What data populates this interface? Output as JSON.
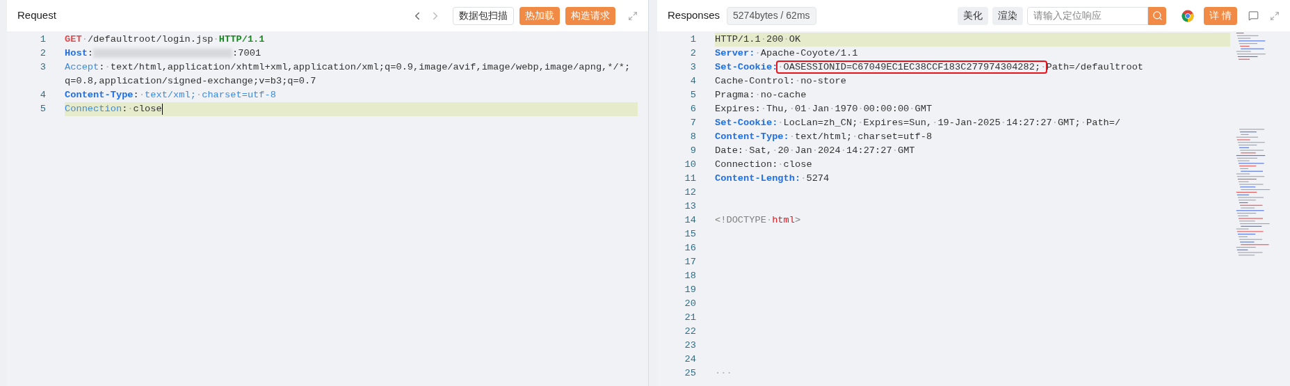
{
  "request": {
    "title": "Request",
    "buttons": [
      {
        "label": "数据包扫描",
        "kind": "outline"
      },
      {
        "label": "热加载",
        "kind": "primary"
      },
      {
        "label": "构造请求",
        "kind": "primary"
      }
    ],
    "lines": [
      {
        "number": "1",
        "current": false,
        "segments": [
          {
            "kind": "method",
            "text": "GET"
          },
          {
            "kind": "value",
            "text": "·/defaultroot/login.jsp·"
          },
          {
            "kind": "protocol",
            "text": "HTTP/1.1"
          }
        ]
      },
      {
        "number": "2",
        "current": false,
        "segments": [
          {
            "kind": "header-bold",
            "text": "Host"
          },
          {
            "kind": "value",
            "text": ":"
          },
          {
            "kind": "redacted"
          },
          {
            "kind": "value",
            "text": ":7001"
          }
        ]
      },
      {
        "number": "3",
        "current": false,
        "segments": [
          {
            "kind": "header",
            "text": "Accept"
          },
          {
            "kind": "value",
            "text": ":·text/html,application/xhtml+xml,application/xml;q=0.9,image/avif,image/webp,image/apng,*/*;"
          }
        ],
        "continuation": "q=0.8,application/signed-exchange;v=b3;q=0.7"
      },
      {
        "number": "4",
        "current": false,
        "segments": [
          {
            "kind": "header-bold",
            "text": "Content-Type"
          },
          {
            "kind": "value",
            "text": ":·"
          },
          {
            "kind": "value-blue",
            "text": "text/xml;·charset=utf-8"
          }
        ]
      },
      {
        "number": "5",
        "current": true,
        "segments": [
          {
            "kind": "header",
            "text": "Connection"
          },
          {
            "kind": "value",
            "text": ":·close"
          }
        ]
      }
    ]
  },
  "response": {
    "title": "Responses",
    "stats": "5274bytes / 62ms",
    "buttons": [
      {
        "label": "美化",
        "kind": "gray"
      },
      {
        "label": "渲染",
        "kind": "gray"
      }
    ],
    "search": {
      "placeholder": "请输入定位响应"
    },
    "detail_button": "详 情",
    "lines": [
      {
        "number": "1",
        "current": true,
        "segments": [
          {
            "kind": "value",
            "text": "HTTP/1.1·200·OK"
          }
        ]
      },
      {
        "number": "2",
        "current": false,
        "segments": [
          {
            "kind": "header-bold",
            "text": "Server:"
          },
          {
            "kind": "value",
            "text": "·Apache-Coyote/1.1"
          }
        ]
      },
      {
        "number": "3",
        "current": false,
        "segments": [
          {
            "kind": "header-bold",
            "text": "Set-Cookie:"
          },
          {
            "kind": "boxed",
            "text": "·OASESSIONID=C67049EC1EC38CCF183C277974304282;·"
          },
          {
            "kind": "value",
            "text": "Path=/defaultroot"
          }
        ]
      },
      {
        "number": "4",
        "current": false,
        "segments": [
          {
            "kind": "value",
            "text": "Cache-Control:·no-store"
          }
        ]
      },
      {
        "number": "5",
        "current": false,
        "segments": [
          {
            "kind": "value",
            "text": "Pragma:·no-cache"
          }
        ]
      },
      {
        "number": "6",
        "current": false,
        "segments": [
          {
            "kind": "value",
            "text": "Expires:·Thu,·01·Jan·1970·00:00:00·GMT"
          }
        ]
      },
      {
        "number": "7",
        "current": false,
        "segments": [
          {
            "kind": "header-bold",
            "text": "Set-Cookie:"
          },
          {
            "kind": "value",
            "text": "·LocLan=zh_CN;·Expires=Sun,·19-Jan-2025·14:27:27·GMT;·Path=/"
          }
        ]
      },
      {
        "number": "8",
        "current": false,
        "segments": [
          {
            "kind": "header-bold",
            "text": "Content-Type:"
          },
          {
            "kind": "value",
            "text": "·text/html;·charset=utf-8"
          }
        ]
      },
      {
        "number": "9",
        "current": false,
        "segments": [
          {
            "kind": "value",
            "text": "Date:·Sat,·20·Jan·2024·14:27:27·GMT"
          }
        ]
      },
      {
        "number": "10",
        "current": false,
        "segments": [
          {
            "kind": "value",
            "text": "Connection:·close"
          }
        ]
      },
      {
        "number": "11",
        "current": false,
        "segments": [
          {
            "kind": "header-bold",
            "text": "Content-Length:"
          },
          {
            "kind": "value",
            "text": "·5274"
          }
        ]
      },
      {
        "number": "12",
        "current": false
      },
      {
        "number": "13",
        "current": false
      },
      {
        "number": "14",
        "current": false,
        "segments": [
          {
            "kind": "punct",
            "text": "<!DOCTYPE·"
          },
          {
            "kind": "tag",
            "text": "html"
          },
          {
            "kind": "punct",
            "text": ">"
          }
        ]
      },
      {
        "number": "15",
        "current": false
      },
      {
        "number": "16",
        "current": false
      },
      {
        "number": "17",
        "current": false
      },
      {
        "number": "18",
        "current": false
      },
      {
        "number": "19",
        "current": false
      },
      {
        "number": "20",
        "current": false
      },
      {
        "number": "21",
        "current": false
      },
      {
        "number": "22",
        "current": false
      },
      {
        "number": "23",
        "current": false
      },
      {
        "number": "24",
        "current": false
      },
      {
        "number": "25",
        "current": false,
        "segments": [
          {
            "kind": "punct",
            "text": "···"
          }
        ]
      }
    ]
  }
}
